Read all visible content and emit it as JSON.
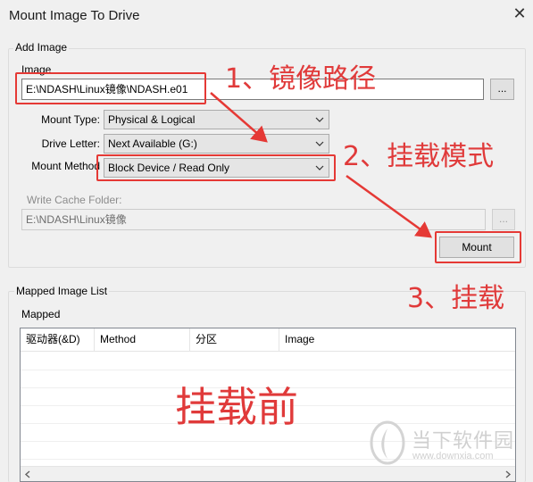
{
  "window": {
    "title": "Mount Image To Drive",
    "close_glyph": "✕"
  },
  "add_image": {
    "legend": "Add Image",
    "image_label": "Image",
    "image_path": "E:\\NDASH\\Linux镜像\\NDASH.e01",
    "browse_label": "...",
    "mount_type_label": "Mount Type:",
    "mount_type_value": "Physical & Logical",
    "drive_letter_label": "Drive Letter:",
    "drive_letter_value": "Next Available (G:)",
    "mount_method_label": "Mount Method",
    "mount_method_value": "Block Device / Read Only",
    "write_cache_label": "Write Cache Folder:",
    "write_cache_path": "E:\\NDASH\\Linux镜像",
    "write_cache_browse_label": "...",
    "mount_button": "Mount"
  },
  "mapped": {
    "legend": "Mapped Image List",
    "sub_label": "Mapped",
    "columns": [
      "驱动器(&D)",
      "Method",
      "分区",
      "Image"
    ]
  },
  "annotations": {
    "step1": "1、镜像路径",
    "step2": "2、挂载模式",
    "step3": "3、挂载",
    "before": "挂载前",
    "accent_color": "#e03a3a"
  },
  "watermark": {
    "name": "当下软件园",
    "url": "www.downxia.com"
  }
}
